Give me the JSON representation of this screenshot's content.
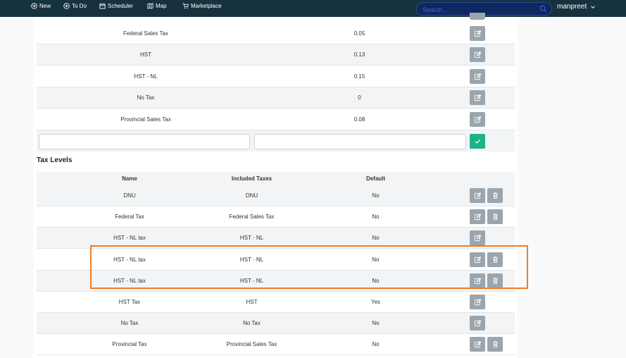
{
  "topbar": {
    "nav": [
      {
        "label": "New",
        "icon": "plus-circle-icon"
      },
      {
        "label": "To Do",
        "icon": "plus-circle-icon"
      },
      {
        "label": "Scheduler",
        "icon": "calendar-icon"
      },
      {
        "label": "Map",
        "icon": "map-icon"
      },
      {
        "label": "Marketplace",
        "icon": "cart-icon"
      }
    ],
    "search_placeholder": "Search...",
    "user_name": "manpreet"
  },
  "taxes": {
    "rows": [
      {
        "name": "Federal Sales Tax",
        "rate": "0.05"
      },
      {
        "name": "HST",
        "rate": "0.13"
      },
      {
        "name": "HST - NL",
        "rate": "0.15"
      },
      {
        "name": "No Tax",
        "rate": "0"
      },
      {
        "name": "Provincial Sales Tax",
        "rate": "0.08"
      }
    ],
    "new_name_value": "",
    "new_rate_value": ""
  },
  "tax_levels": {
    "title": "Tax Levels",
    "headers": {
      "name": "Name",
      "included": "Included Taxes",
      "default": "Default"
    },
    "rows": [
      {
        "name": "DNU",
        "included": "DNU",
        "default": "No",
        "deletable": true
      },
      {
        "name": "Federal Tax",
        "included": "Federal Sales Tax",
        "default": "No",
        "deletable": true
      },
      {
        "name": "HST - NL tax",
        "included": "HST - NL",
        "default": "No",
        "deletable": false
      },
      {
        "name": "HST - NL tax",
        "included": "HST - NL",
        "default": "No",
        "deletable": true
      },
      {
        "name": "HST - NL tax",
        "included": "HST - NL",
        "default": "No",
        "deletable": true
      },
      {
        "name": "HST Tax",
        "included": "HST",
        "default": "Yes",
        "deletable": false
      },
      {
        "name": "No Tax",
        "included": "No Tax",
        "default": "No",
        "deletable": false
      },
      {
        "name": "Provincial Tax",
        "included": "Provincial Sales Tax",
        "default": "No",
        "deletable": true
      }
    ]
  },
  "colors": {
    "topbar": "#17323f",
    "action_button": "#9aa5ad",
    "confirm_button": "#1eb28b",
    "highlight": "#f07d24"
  }
}
